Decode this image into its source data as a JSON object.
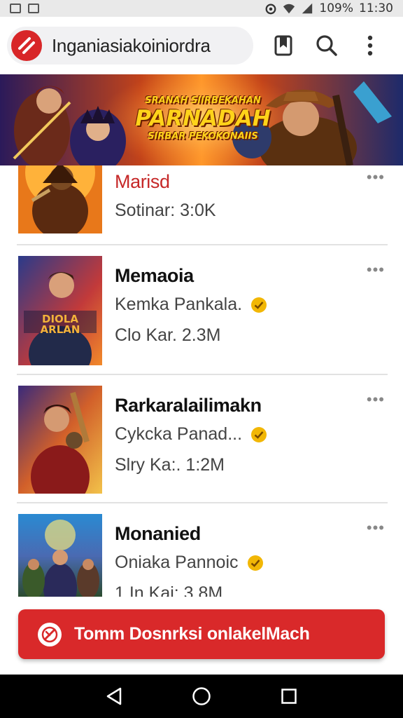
{
  "status_bar": {
    "battery": "109%",
    "time": "11:30"
  },
  "top_bar": {
    "url_text": "Inganiasiakoiniordra"
  },
  "banner": {
    "line1": "SRANAH SIIRBEKAHAN",
    "line2": "PARNADAH",
    "line3": "SIRBAR PEKOKONAIIS"
  },
  "items": [
    {
      "title": "Marisd",
      "subtitle": "",
      "stat": "Sotinar: 3:0K",
      "more": "•••"
    },
    {
      "title": "Memaoia",
      "subtitle": "Kemka Pankala.",
      "stat": "Clo Kar. 2.3M",
      "more": "•••",
      "poster_text": "DIOLA ARLAN"
    },
    {
      "title": "Rarkaralailimakn",
      "subtitle": "Cykcka Panad...",
      "stat": "Slry Ka:. 1:2M",
      "more": "•••"
    },
    {
      "title": "Monanied",
      "subtitle": "Oniaka Pannoic",
      "stat": "1 In Kai: 3.8M",
      "more": "•••"
    }
  ],
  "action_button": {
    "label": "Tomm Dosnrksi onlakelMach"
  },
  "colors": {
    "accent_red": "#d9292a",
    "verified_gold": "#f2b705"
  }
}
